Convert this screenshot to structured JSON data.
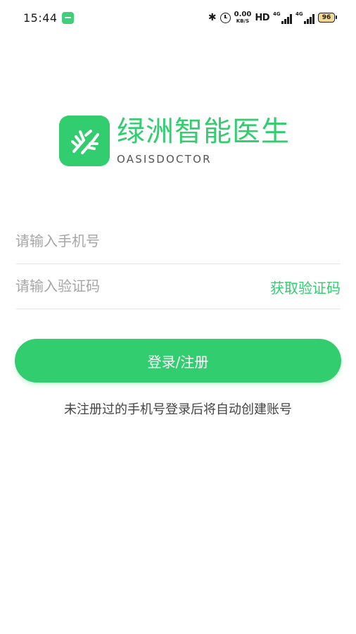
{
  "status_bar": {
    "time": "15:44",
    "net_speed_value": "0.00",
    "net_speed_unit": "KB/S",
    "hd_label": "HD",
    "signal_1_label": "4G",
    "signal_2_label": "4G",
    "battery_level": "96"
  },
  "brand": {
    "name": "绿洲智能医生",
    "subtitle": "OASISDOCTOR",
    "color": "#31cd6e"
  },
  "login_form": {
    "phone_placeholder": "请输入手机号",
    "code_placeholder": "请输入验证码",
    "get_code_label": "获取验证码",
    "submit_label": "登录/注册",
    "hint": "未注册过的手机号登录后将自动创建账号"
  }
}
